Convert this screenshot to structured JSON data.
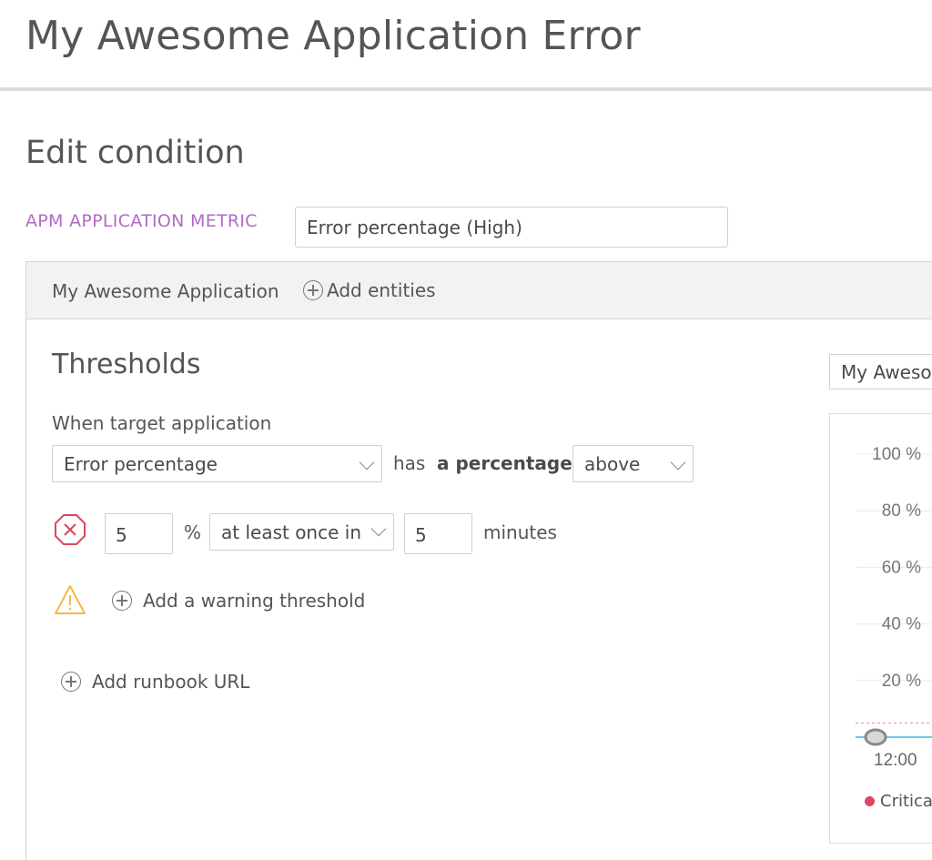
{
  "app": {
    "title": "My Awesome Application Error"
  },
  "page": {
    "title": "Edit condition"
  },
  "metric": {
    "label": "APM APPLICATION METRIC",
    "value": "Error percentage (High)"
  },
  "entities": {
    "name": "My Awesome Application",
    "add_label": "Add entities"
  },
  "thresholds": {
    "title": "Thresholds",
    "when_label": "When target application",
    "metric_select": "Error percentage",
    "has_text": "has",
    "a_percentage_text": "a percentage",
    "operator_select": "above",
    "critical": {
      "value": "5",
      "unit": "%",
      "occurrence_select": "at least once in",
      "duration": "5",
      "duration_unit": "minutes"
    },
    "add_warning_label": "Add a warning threshold",
    "add_runbook_label": "Add runbook URL"
  },
  "chart_select": {
    "value": "My Aweso"
  },
  "icons": {
    "critical": "critical-octagon-icon",
    "warning": "warning-triangle-icon",
    "add": "circle-plus-icon",
    "dropdown": "chevron-down-icon"
  },
  "colors": {
    "metric_label": "#b06bc6",
    "critical": "#d9485f",
    "warning": "#f5b843",
    "series_line": "#6cc9e8"
  },
  "chart_data": {
    "type": "line",
    "yticks": [
      "100 %",
      "80 %",
      "60 %",
      "40 %",
      "20 %"
    ],
    "y_values": [
      100,
      80,
      60,
      40,
      20
    ],
    "ylim": [
      0,
      100
    ],
    "xticks": [
      "12:00"
    ],
    "critical_threshold": 5,
    "series": [
      {
        "values": [
          0,
          0
        ]
      }
    ],
    "legend": [
      "Critica"
    ]
  }
}
